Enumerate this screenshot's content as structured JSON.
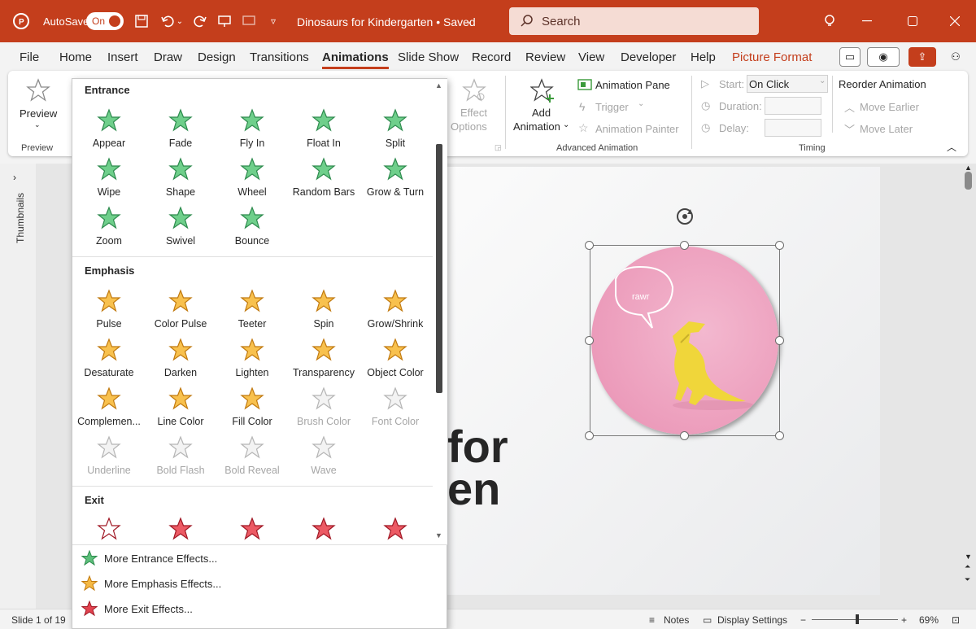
{
  "titlebar": {
    "autosave_label": "AutoSave",
    "autosave_state": "On",
    "doc_title": "Dinosaurs for Kindergarten • Saved",
    "search_placeholder": "Search",
    "accent": "#c43e1c"
  },
  "menu": {
    "tabs": [
      "File",
      "Home",
      "Insert",
      "Draw",
      "Design",
      "Transitions",
      "Animations",
      "Slide Show",
      "Record",
      "Review",
      "View",
      "Developer",
      "Help",
      "Picture Format"
    ],
    "active": "Animations"
  },
  "ribbon": {
    "preview_label": "Preview",
    "preview_group": "Preview",
    "effect_options": [
      "Effect",
      "Options"
    ],
    "add_animation": [
      "Add",
      "Animation"
    ],
    "animation_pane": "Animation Pane",
    "trigger": "Trigger",
    "animation_painter": "Animation Painter",
    "advanced_group": "Advanced Animation",
    "start_label": "Start:",
    "start_value": "On Click",
    "duration_label": "Duration:",
    "delay_label": "Delay:",
    "timing_group": "Timing",
    "reorder_title": "Reorder Animation",
    "move_earlier": "Move Earlier",
    "move_later": "Move Later"
  },
  "gallery": {
    "entrance_title": "Entrance",
    "entrance": [
      "Appear",
      "Fade",
      "Fly In",
      "Float In",
      "Split",
      "Wipe",
      "Shape",
      "Wheel",
      "Random Bars",
      "Grow & Turn",
      "Zoom",
      "Swivel",
      "Bounce"
    ],
    "emphasis_title": "Emphasis",
    "emphasis": [
      "Pulse",
      "Color Pulse",
      "Teeter",
      "Spin",
      "Grow/Shrink",
      "Desaturate",
      "Darken",
      "Lighten",
      "Transparency",
      "Object Color",
      "Complemen...",
      "Line Color",
      "Fill Color",
      "Brush Color",
      "Font Color",
      "Underline",
      "Bold Flash",
      "Bold Reveal",
      "Wave"
    ],
    "emphasis_disabled": [
      "Brush Color",
      "Font Color",
      "Underline",
      "Bold Flash",
      "Bold Reveal",
      "Wave"
    ],
    "exit_title": "Exit",
    "more": [
      "More Entrance Effects...",
      "More Emphasis Effects...",
      "More Exit Effects..."
    ]
  },
  "workspace": {
    "thumbnails_label": "Thumbnails",
    "slide_text_1": "for",
    "slide_text_2": "en",
    "bubble_text": "rawr"
  },
  "status": {
    "slide_info": "Slide 1 of 19",
    "notes": "Notes",
    "display_settings": "Display Settings",
    "zoom": "69%",
    "zoom_level": 0.69
  }
}
